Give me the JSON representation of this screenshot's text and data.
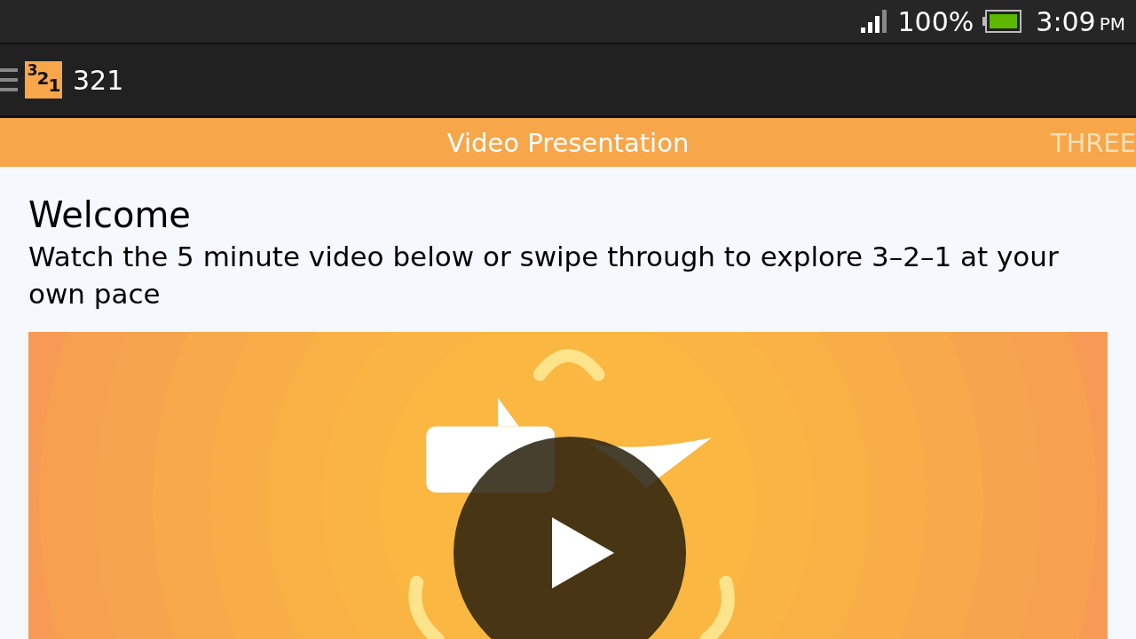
{
  "status_bar": {
    "battery_percent": "100%",
    "time": "3:09",
    "meridiem": "PM"
  },
  "action_bar": {
    "logo_text": "321",
    "title": "321"
  },
  "tabs": [
    {
      "label": "Video Presentation",
      "selected": true
    },
    {
      "label": "THREE",
      "selected": false
    }
  ],
  "content": {
    "heading": "Welcome",
    "intro": "Watch the 5 minute video below or swipe through to explore 3–2–1 at your own pace"
  }
}
